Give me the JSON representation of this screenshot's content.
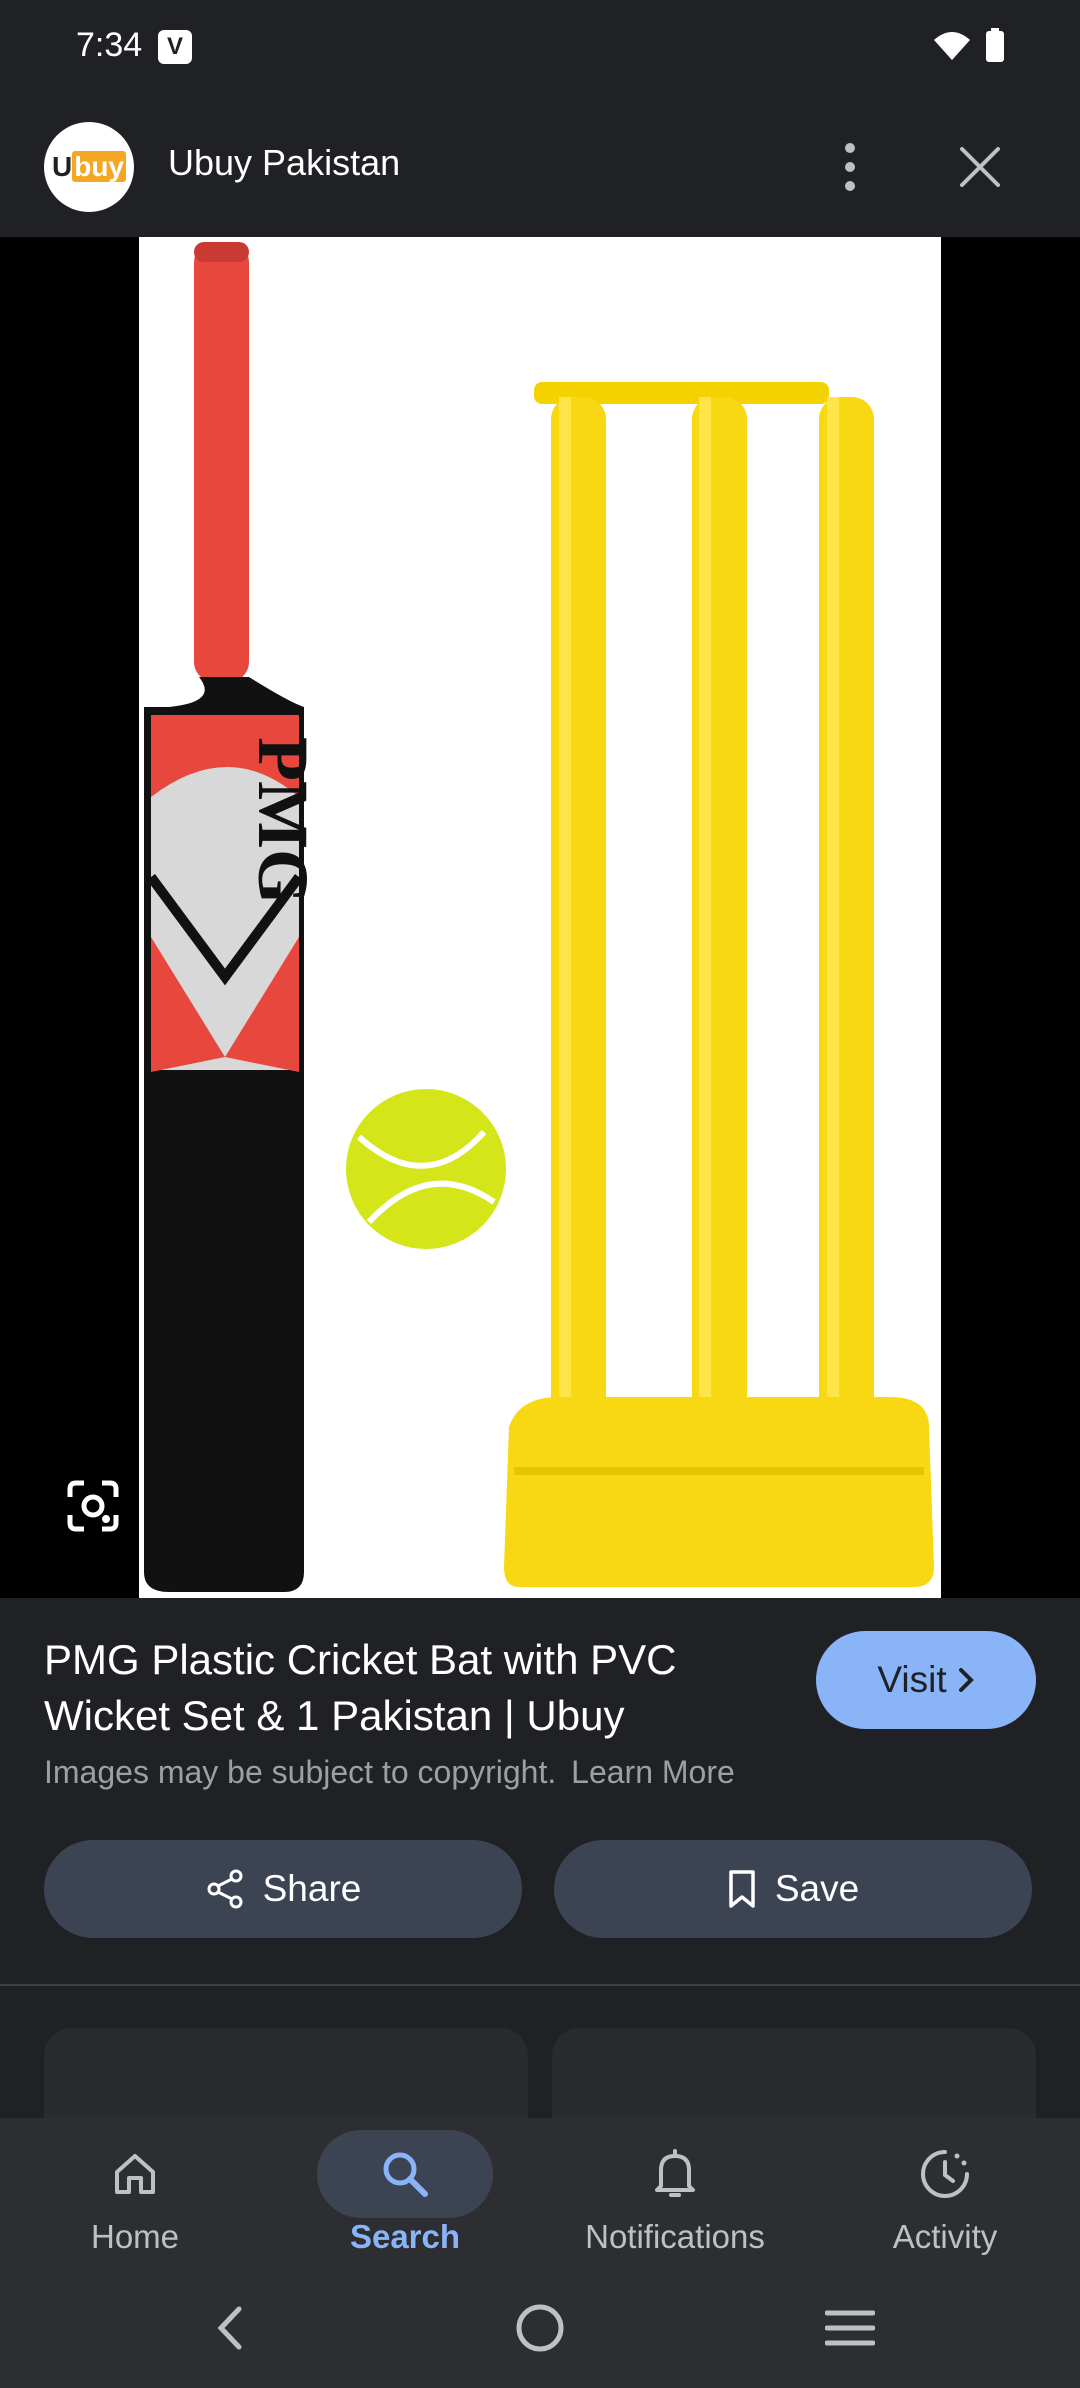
{
  "status_bar": {
    "time": "7:34",
    "app_badge": "V"
  },
  "header": {
    "site_name": "Ubuy Pakistan",
    "logo_text_a": "U",
    "logo_text_b": "buy"
  },
  "image": {
    "brand_mark": "PMG"
  },
  "details": {
    "title": "PMG Plastic Cricket Bat with PVC Wicket Set & 1 Pakistan | Ubuy",
    "visit_label": "Visit",
    "copyright_text": "Images may be subject to copyright.",
    "learn_more_label": "Learn More",
    "share_label": "Share",
    "save_label": "Save"
  },
  "bottom_nav": {
    "items": [
      {
        "label": "Home",
        "icon": "home-icon",
        "active": false
      },
      {
        "label": "Search",
        "icon": "search-icon",
        "active": true
      },
      {
        "label": "Notifications",
        "icon": "bell-icon",
        "active": false
      },
      {
        "label": "Activity",
        "icon": "activity-icon",
        "active": false
      }
    ]
  },
  "colors": {
    "accent": "#8ab4f8",
    "background": "#202124",
    "button_bg": "#3c4453"
  }
}
